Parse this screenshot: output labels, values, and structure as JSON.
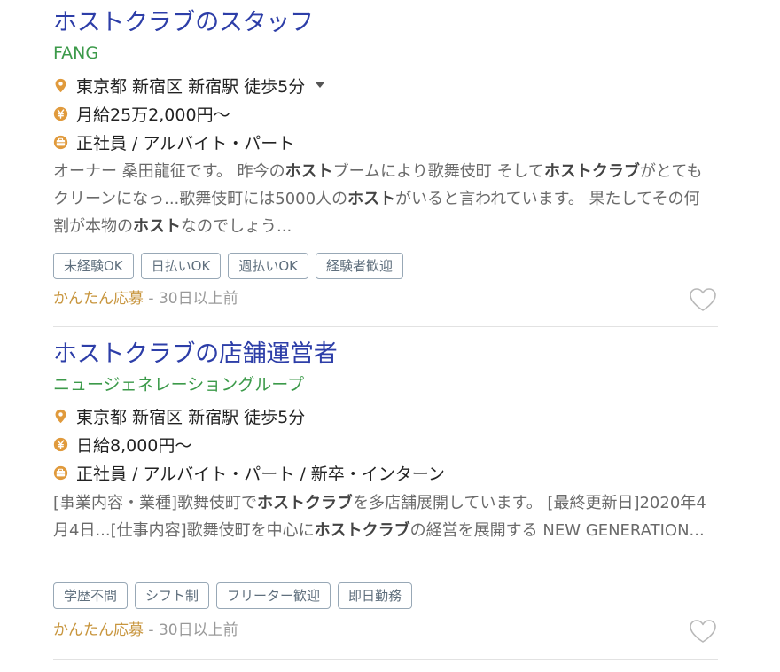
{
  "jobs": [
    {
      "title": "ホストクラブのスタッフ",
      "company": "FANG",
      "location": "東京都 新宿区 新宿駅 徒歩5分",
      "location_icon": "map-pin-icon",
      "has_location_dropdown": true,
      "salary": "月給25万2,000円〜",
      "salary_icon": "yen-icon",
      "employment": "正社員 / アルバイト・パート",
      "employment_icon": "briefcase-icon",
      "snippet": [
        {
          "t": "オーナー 桑田龍征です。 昨今の",
          "b": false
        },
        {
          "t": "ホスト",
          "b": true
        },
        {
          "t": "ブームにより歌舞伎町 そして",
          "b": false
        },
        {
          "t": "ホストクラブ",
          "b": true
        },
        {
          "t": "がとてもクリーンになっ...歌舞伎町には5000人の",
          "b": false
        },
        {
          "t": "ホスト",
          "b": true
        },
        {
          "t": "がいると言われています。 果たしてその何割が本物の",
          "b": false
        },
        {
          "t": "ホスト",
          "b": true
        },
        {
          "t": "なのでしょう...",
          "b": false
        }
      ],
      "tags": [
        "未経験OK",
        "日払いOK",
        "週払いOK",
        "経験者歓迎"
      ],
      "easy_apply": "かんたん応募",
      "separator": "-",
      "posted": "30日以上前",
      "favorite_icon": "heart-icon"
    },
    {
      "title": "ホストクラブの店舗運営者",
      "company": "ニュージェネレーショングループ",
      "location": "東京都 新宿区 新宿駅 徒歩5分",
      "location_icon": "map-pin-icon",
      "has_location_dropdown": false,
      "salary": "日給8,000円〜",
      "salary_icon": "yen-icon",
      "employment": "正社員 / アルバイト・パート / 新卒・インターン",
      "employment_icon": "briefcase-icon",
      "snippet": [
        {
          "t": "[事業内容・業種]歌舞伎町で",
          "b": false
        },
        {
          "t": "ホストクラブ",
          "b": true
        },
        {
          "t": "を多店舗展開しています。 [最終更新日]2020年4月4日...[仕事内容]歌舞伎町を中心に",
          "b": false
        },
        {
          "t": "ホストクラブ",
          "b": true
        },
        {
          "t": "の経営を展開する NEW GENERATION...",
          "b": false
        }
      ],
      "tags": [
        "学歴不問",
        "シフト制",
        "フリーター歓迎",
        "即日勤務"
      ],
      "easy_apply": "かんたん応募",
      "separator": "-",
      "posted": "30日以上前",
      "favorite_icon": "heart-icon"
    }
  ],
  "colors": {
    "title": "#2d3ea8",
    "company": "#3c9a4a",
    "icon": "#e09a3c",
    "easy_apply": "#c8963f"
  }
}
